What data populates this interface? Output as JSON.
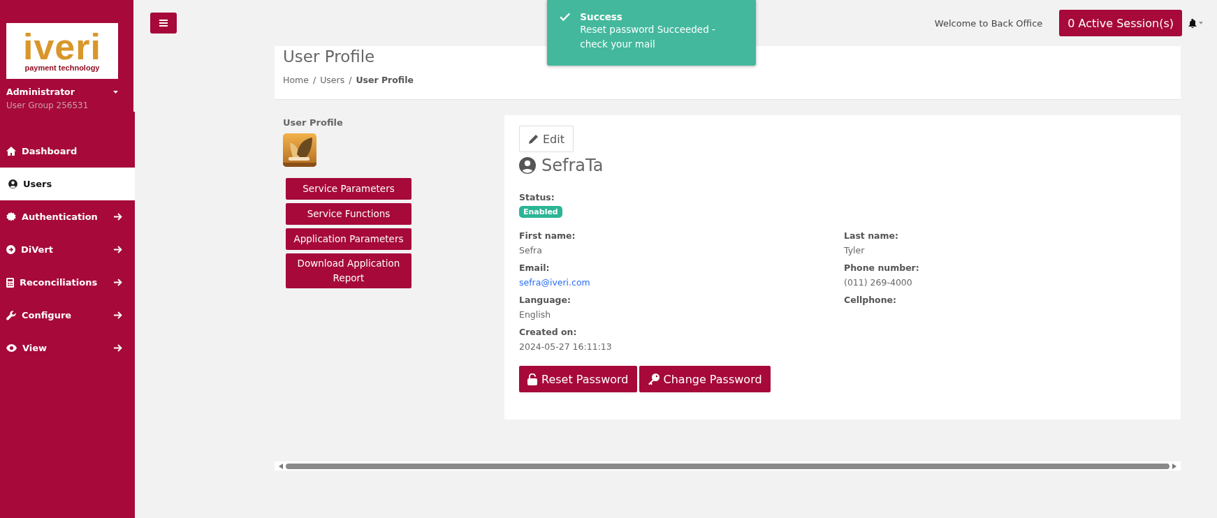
{
  "sidebar": {
    "logo": {
      "brand": "iveri",
      "tagline": "payment technology"
    },
    "user": {
      "name": "Administrator",
      "group": "User Group 256531"
    },
    "items": [
      {
        "label": "Dashboard",
        "selected": false,
        "expandable": false
      },
      {
        "label": "Users",
        "selected": true,
        "expandable": false
      },
      {
        "label": "Authentication",
        "selected": false,
        "expandable": true
      },
      {
        "label": "DiVert",
        "selected": false,
        "expandable": true
      },
      {
        "label": "Reconciliations",
        "selected": false,
        "expandable": true
      },
      {
        "label": "Configure",
        "selected": false,
        "expandable": true
      },
      {
        "label": "View",
        "selected": false,
        "expandable": true
      }
    ]
  },
  "topbar": {
    "welcome": "Welcome to Back Office",
    "sessions_button": "0 Active Session(s)"
  },
  "toast": {
    "title": "Success",
    "message": "Reset password Succeeded - check your mail"
  },
  "page_header": {
    "title": "User Profile",
    "separator": "/",
    "breadcrumb": [
      {
        "label": "Home",
        "current": false
      },
      {
        "label": "Users",
        "current": false
      },
      {
        "label": "User Profile",
        "current": true
      }
    ]
  },
  "left_panel": {
    "title": "User Profile",
    "buttons": [
      "Service Parameters",
      "Service Functions",
      "Application Parameters",
      "Download Application Report"
    ]
  },
  "profile": {
    "edit_button": "Edit",
    "username": "SefraTa",
    "status_label": "Status:",
    "status": "Enabled",
    "fields": [
      {
        "label": "First name:",
        "value": "Sefra"
      },
      {
        "label": "Last name:",
        "value": "Tyler"
      },
      {
        "label": "Email:",
        "value": "sefra@iveri.com",
        "kind": "link"
      },
      {
        "label": "Phone number:",
        "value": "(011) 269-4000"
      },
      {
        "label": "Language:",
        "value": "English"
      },
      {
        "label": "Cellphone:"
      },
      {
        "label": "Created on:",
        "value": "2024-05-27 16:11:13"
      }
    ],
    "actions": [
      "Reset Password",
      "Change Password"
    ]
  }
}
